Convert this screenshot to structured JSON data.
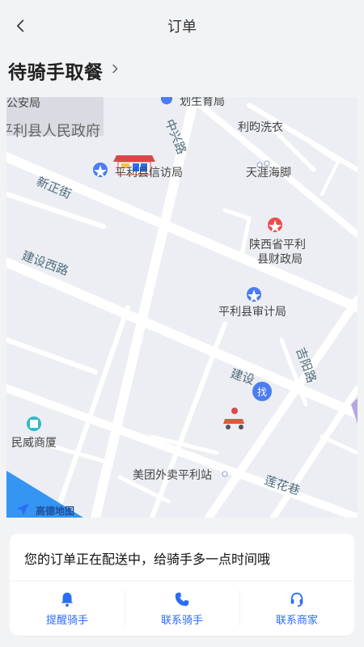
{
  "header": {
    "title": "订单"
  },
  "status": {
    "text": "待骑手取餐"
  },
  "map": {
    "labels": {
      "gongan": "公安局",
      "government": "平利县人民政府",
      "tiyu": "划生育局",
      "xinfang": "平利县信访局",
      "xinzheng_street": "新正街",
      "zhongxing_rd": "中兴路",
      "liyun": "利昀洗衣",
      "tianya": "天涯海脚",
      "caizheng": "陕西省平利县财政局",
      "caizheng_line1": "陕西省平利",
      "caizheng_line2": "县财政局",
      "shenji": "平利县审计局",
      "jianshe_west": "建设西路",
      "jianshe": "建设",
      "jiyang": "吉阳路",
      "minwei": "民威商厦",
      "meituan": "美团外卖平利站",
      "lianhua": "莲花巷",
      "find_badge": "找"
    },
    "logo": {
      "text": "高德地图"
    }
  },
  "card": {
    "message": "您的订单正在配送中，给骑手多一点时间哦",
    "actions": [
      {
        "label": "提醒骑手",
        "icon": "bell-icon"
      },
      {
        "label": "联系骑手",
        "icon": "phone-icon"
      },
      {
        "label": "联系商家",
        "icon": "headset-icon"
      }
    ]
  },
  "colors": {
    "accent": "#2a6df6",
    "map_bg": "#eceef3",
    "road": "#ffffff",
    "poi_blue": "#4b7cf0",
    "poi_red": "#ee4b4b"
  }
}
